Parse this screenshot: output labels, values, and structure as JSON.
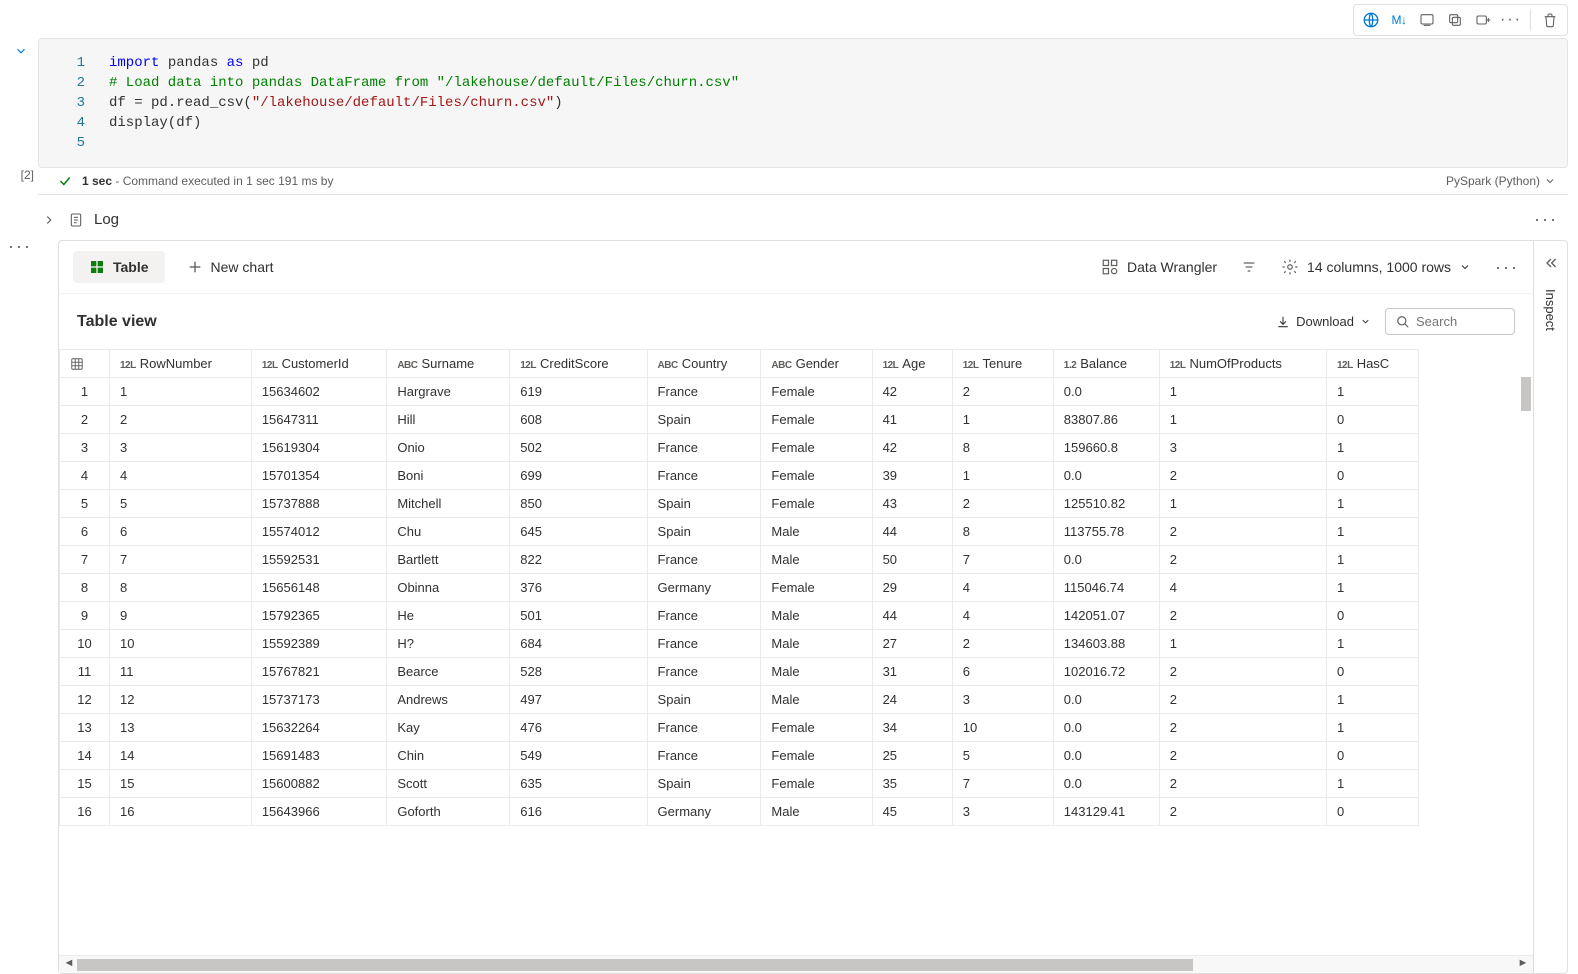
{
  "toolbar": {
    "markdown_label": "M↓"
  },
  "code": {
    "lines": [
      {
        "n": "1",
        "segments": [
          {
            "t": "import",
            "c": "kw"
          },
          {
            "t": " pandas ",
            "c": ""
          },
          {
            "t": "as",
            "c": "kw"
          },
          {
            "t": " pd",
            "c": ""
          }
        ]
      },
      {
        "n": "2",
        "segments": [
          {
            "t": "# Load data into pandas DataFrame from \"/lakehouse/default/Files/churn.csv\"",
            "c": "cm"
          }
        ]
      },
      {
        "n": "3",
        "segments": [
          {
            "t": "df = pd.read_csv(",
            "c": ""
          },
          {
            "t": "\"/lakehouse/default/Files/churn.csv\"",
            "c": "str"
          },
          {
            "t": ")",
            "c": ""
          }
        ]
      },
      {
        "n": "4",
        "segments": [
          {
            "t": "display(df)",
            "c": ""
          }
        ]
      },
      {
        "n": "5",
        "segments": [
          {
            "t": "",
            "c": ""
          }
        ]
      }
    ]
  },
  "exec": {
    "index": "[2]",
    "duration_bold": "1 sec",
    "msg": "- Command executed in 1 sec 191 ms by",
    "lang": "PySpark (Python)"
  },
  "log": {
    "label": "Log"
  },
  "pane": {
    "tabs": {
      "table": "Table",
      "newchart": "New chart"
    },
    "right": {
      "wrangler": "Data Wrangler",
      "summary": "14 columns, 1000 rows"
    },
    "toolbar": {
      "title": "Table view",
      "download": "Download",
      "search_ph": "Search"
    },
    "inspect": "Inspect"
  },
  "table": {
    "columns": [
      {
        "typ": "12L",
        "name": "RowNumber"
      },
      {
        "typ": "12L",
        "name": "CustomerId"
      },
      {
        "typ": "ABC",
        "name": "Surname"
      },
      {
        "typ": "12L",
        "name": "CreditScore"
      },
      {
        "typ": "ABC",
        "name": "Country"
      },
      {
        "typ": "ABC",
        "name": "Gender"
      },
      {
        "typ": "12L",
        "name": "Age"
      },
      {
        "typ": "12L",
        "name": "Tenure"
      },
      {
        "typ": "1.2",
        "name": "Balance"
      },
      {
        "typ": "12L",
        "name": "NumOfProducts"
      },
      {
        "typ": "12L",
        "name": "HasC"
      }
    ],
    "rows": [
      [
        "1",
        "1",
        "15634602",
        "Hargrave",
        "619",
        "France",
        "Female",
        "42",
        "2",
        "0.0",
        "1",
        "1"
      ],
      [
        "2",
        "2",
        "15647311",
        "Hill",
        "608",
        "Spain",
        "Female",
        "41",
        "1",
        "83807.86",
        "1",
        "0"
      ],
      [
        "3",
        "3",
        "15619304",
        "Onio",
        "502",
        "France",
        "Female",
        "42",
        "8",
        "159660.8",
        "3",
        "1"
      ],
      [
        "4",
        "4",
        "15701354",
        "Boni",
        "699",
        "France",
        "Female",
        "39",
        "1",
        "0.0",
        "2",
        "0"
      ],
      [
        "5",
        "5",
        "15737888",
        "Mitchell",
        "850",
        "Spain",
        "Female",
        "43",
        "2",
        "125510.82",
        "1",
        "1"
      ],
      [
        "6",
        "6",
        "15574012",
        "Chu",
        "645",
        "Spain",
        "Male",
        "44",
        "8",
        "113755.78",
        "2",
        "1"
      ],
      [
        "7",
        "7",
        "15592531",
        "Bartlett",
        "822",
        "France",
        "Male",
        "50",
        "7",
        "0.0",
        "2",
        "1"
      ],
      [
        "8",
        "8",
        "15656148",
        "Obinna",
        "376",
        "Germany",
        "Female",
        "29",
        "4",
        "115046.74",
        "4",
        "1"
      ],
      [
        "9",
        "9",
        "15792365",
        "He",
        "501",
        "France",
        "Male",
        "44",
        "4",
        "142051.07",
        "2",
        "0"
      ],
      [
        "10",
        "10",
        "15592389",
        "H?",
        "684",
        "France",
        "Male",
        "27",
        "2",
        "134603.88",
        "1",
        "1"
      ],
      [
        "11",
        "11",
        "15767821",
        "Bearce",
        "528",
        "France",
        "Male",
        "31",
        "6",
        "102016.72",
        "2",
        "0"
      ],
      [
        "12",
        "12",
        "15737173",
        "Andrews",
        "497",
        "Spain",
        "Male",
        "24",
        "3",
        "0.0",
        "2",
        "1"
      ],
      [
        "13",
        "13",
        "15632264",
        "Kay",
        "476",
        "France",
        "Female",
        "34",
        "10",
        "0.0",
        "2",
        "1"
      ],
      [
        "14",
        "14",
        "15691483",
        "Chin",
        "549",
        "France",
        "Female",
        "25",
        "5",
        "0.0",
        "2",
        "0"
      ],
      [
        "15",
        "15",
        "15600882",
        "Scott",
        "635",
        "Spain",
        "Female",
        "35",
        "7",
        "0.0",
        "2",
        "1"
      ],
      [
        "16",
        "16",
        "15643966",
        "Goforth",
        "616",
        "Germany",
        "Male",
        "45",
        "3",
        "143129.41",
        "2",
        "0"
      ]
    ]
  }
}
